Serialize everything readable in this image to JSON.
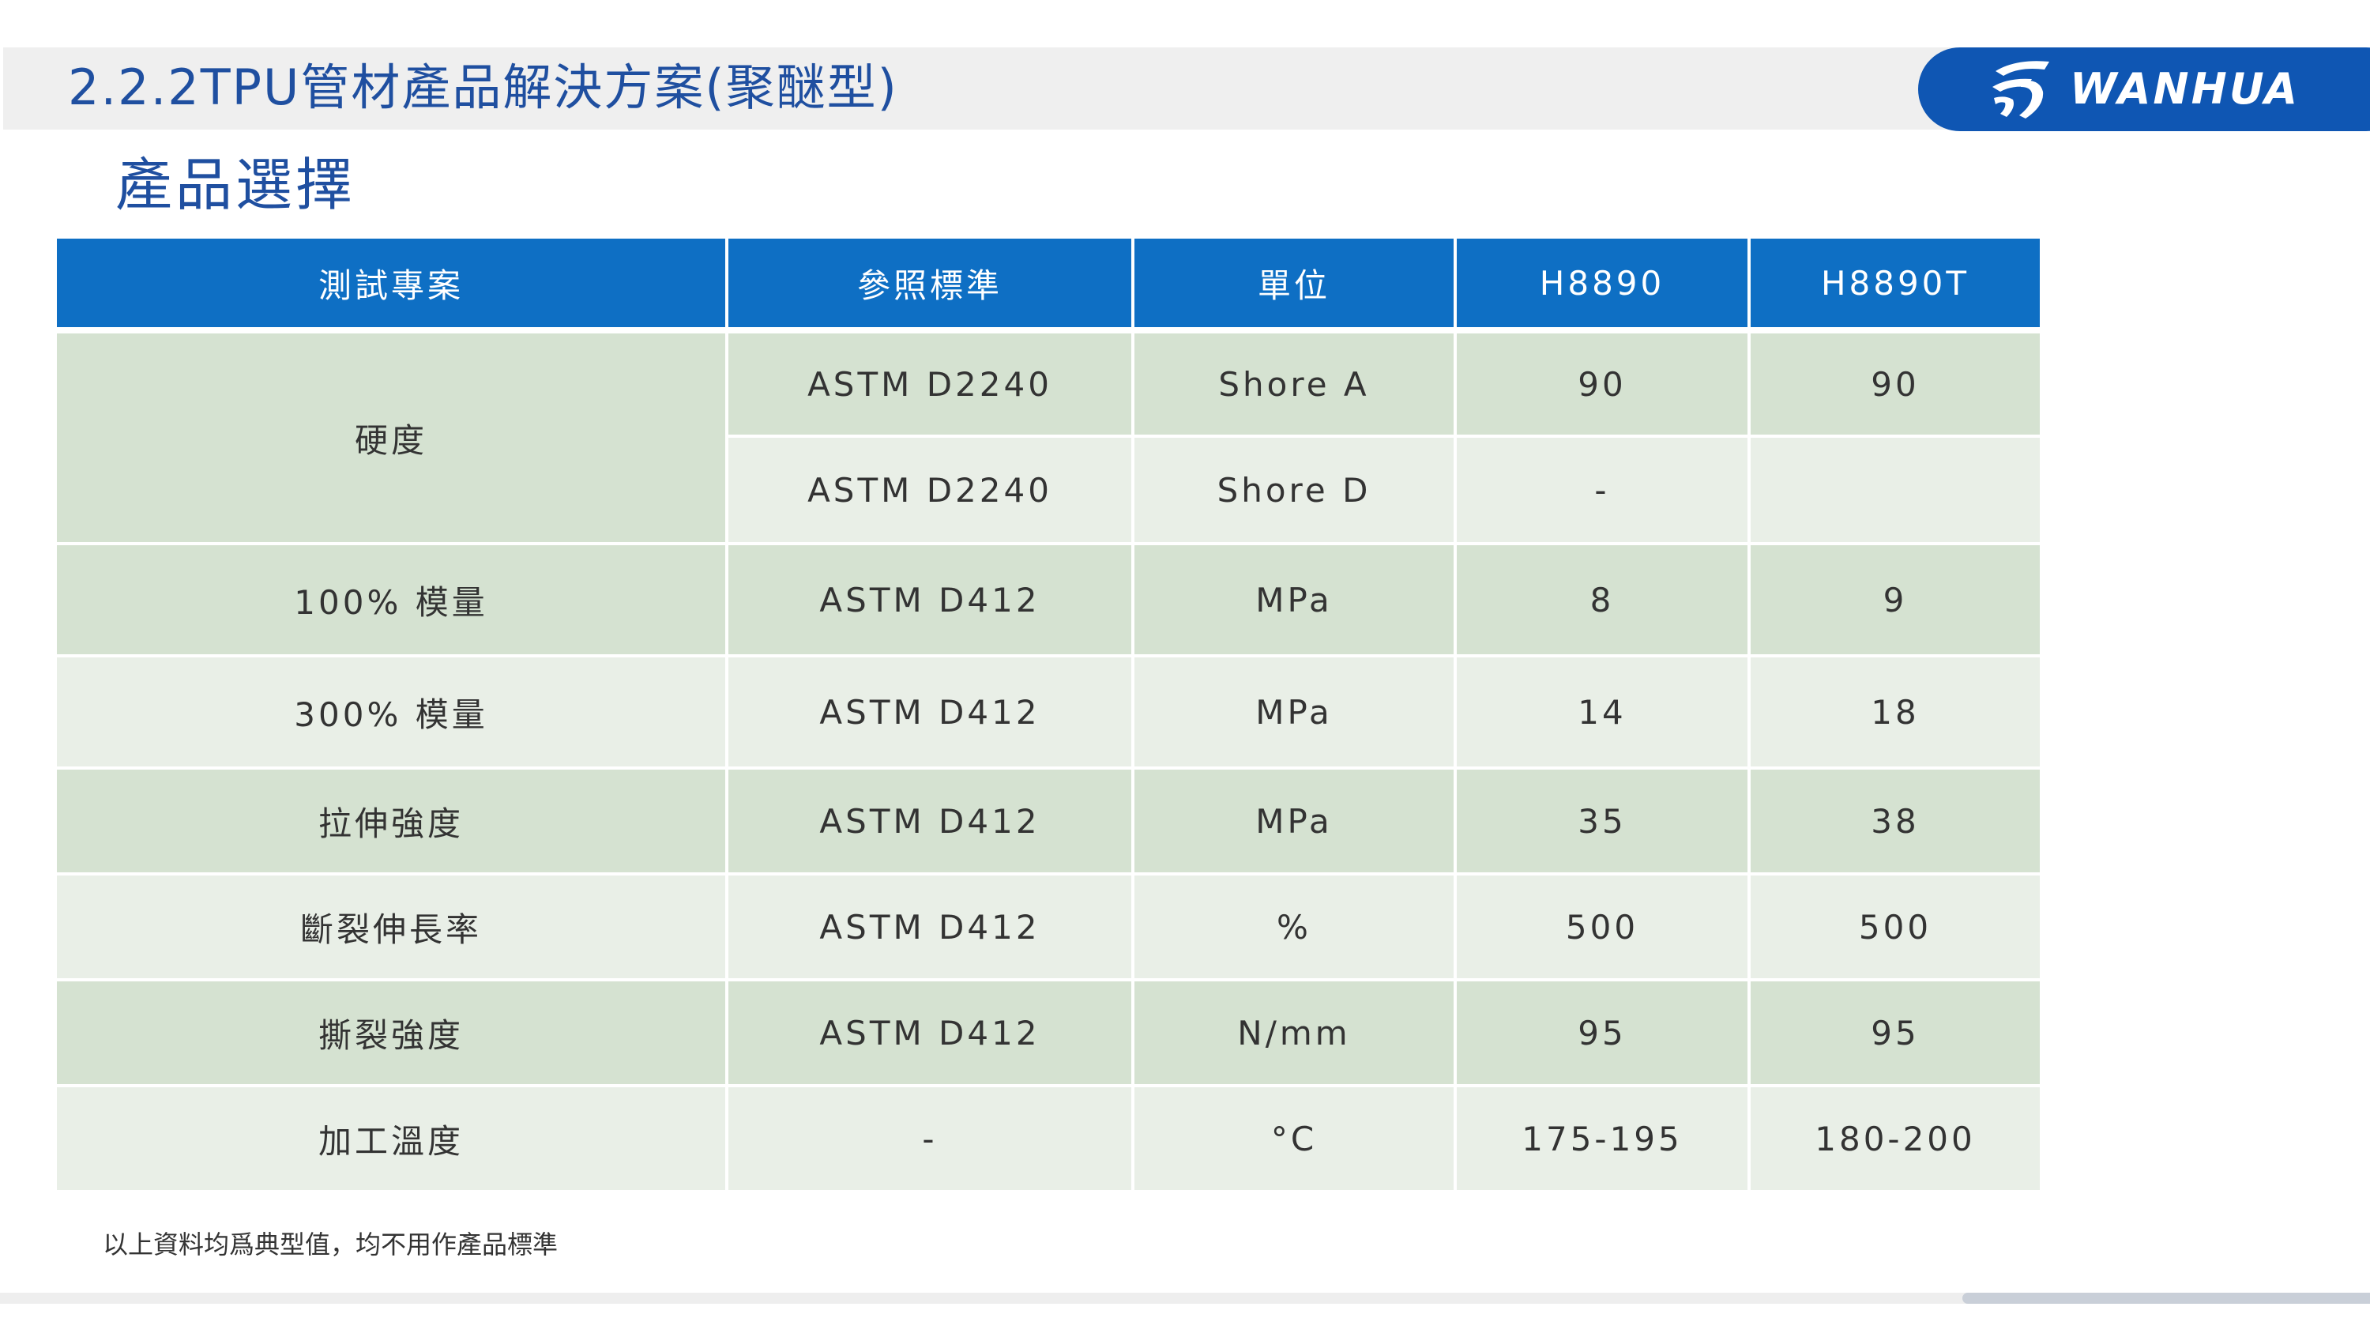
{
  "header": {
    "section_title": "2.2.2TPU管材產品解決方案(聚醚型)",
    "brand": "WANHUA",
    "brand_color": "#0f56b3",
    "logo_icon": "wanhua-logo-icon"
  },
  "subtitle": "產品選擇",
  "table": {
    "header_color": "#0e6fc4",
    "columns": [
      "測試專案",
      "參照標準",
      "單位",
      "H8890",
      "H8890T"
    ],
    "rows": {
      "hardness": {
        "item": "硬度",
        "a": {
          "standard": "ASTM D2240",
          "unit": "Shore A",
          "h8890": "90",
          "h8890t": "90"
        },
        "d": {
          "standard": "ASTM D2240",
          "unit": "Shore D",
          "h8890": "-",
          "h8890t": ""
        }
      },
      "modulus100": {
        "item": "100% 模量",
        "standard": "ASTM D412",
        "unit": "MPa",
        "h8890": "8",
        "h8890t": "9"
      },
      "modulus300": {
        "item": "300% 模量",
        "standard": "ASTM D412",
        "unit": "MPa",
        "h8890": "14",
        "h8890t": "18"
      },
      "tensile": {
        "item": "拉伸強度",
        "standard": "ASTM D412",
        "unit": "MPa",
        "h8890": "35",
        "h8890t": "38"
      },
      "elongation": {
        "item": "斷裂伸長率",
        "standard": "ASTM D412",
        "unit": "%",
        "h8890": "500",
        "h8890t": "500"
      },
      "tear": {
        "item": "撕裂強度",
        "standard": "ASTM D412",
        "unit": "N/mm",
        "h8890": "95",
        "h8890t": "95"
      },
      "processing_temp": {
        "item": "加工溫度",
        "standard": "-",
        "unit": "°C",
        "h8890": "175-195",
        "h8890t": "180-200"
      }
    }
  },
  "footnote": "以上資料均爲典型值，均不用作產品標準"
}
